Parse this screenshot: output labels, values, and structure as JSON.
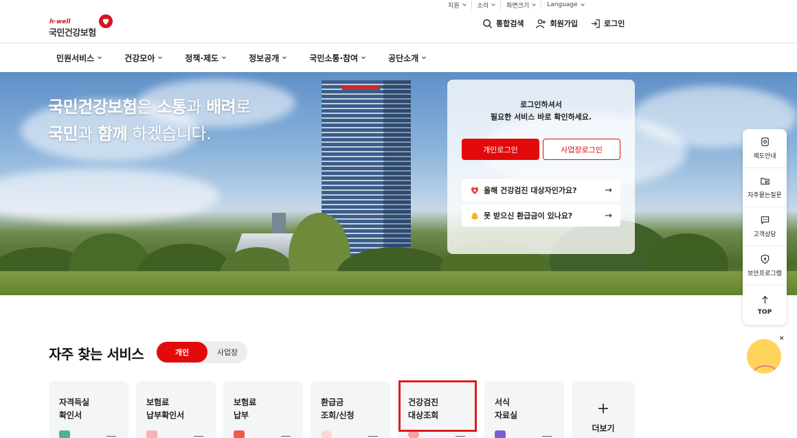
{
  "utility": [
    "지원",
    "소리",
    "화면크기",
    "Language"
  ],
  "logo": {
    "tag": "h·well",
    "name": "국민건강보험"
  },
  "header_actions": {
    "search": "통합검색",
    "join": "회원가입",
    "login": "로그인"
  },
  "gnb": [
    "민원서비스",
    "건강모아",
    "정책·제도",
    "정보공개",
    "국민소통·참여",
    "공단소개"
  ],
  "hero": {
    "line1_a": "국민건강보험",
    "line1_b": "은 ",
    "line1_c": "소통",
    "line1_d": "과 ",
    "line1_e": "배려",
    "line1_f": "로",
    "line2_a": "국민",
    "line2_b": "과 ",
    "line2_c": "함께",
    "line2_d": " 하겠습니다."
  },
  "login_card": {
    "line1": "로그인하셔서",
    "line2": "필요한 서비스 바로 확인하세요.",
    "personal": "개인로그인",
    "business": "사업장로그인",
    "row1": "올해 건강검진 대상자인가요?",
    "row2": "못 받으신 환급금이 있나요?",
    "arrow": "→"
  },
  "quick_menu": [
    "제도안내",
    "자주묻는질문",
    "고객상담",
    "보안프로그램",
    "TOP"
  ],
  "chatbot_close": "×",
  "frequent": {
    "title": "자주 찾는 서비스",
    "tab_personal": "개인",
    "tab_business": "사업장",
    "cards": [
      {
        "l1": "자격득실",
        "l2": "확인서"
      },
      {
        "l1": "보험료",
        "l2": "납부확인서"
      },
      {
        "l1": "보험료",
        "l2": "납부"
      },
      {
        "l1": "환급금",
        "l2": "조회/신청"
      },
      {
        "l1": "건강검진",
        "l2": "대상조회"
      },
      {
        "l1": "서식",
        "l2": "자료실"
      }
    ],
    "more": "더보기",
    "more_icon": "+"
  },
  "colors": {
    "brand": "#e20a0a",
    "highlight": "#e11b1b"
  }
}
